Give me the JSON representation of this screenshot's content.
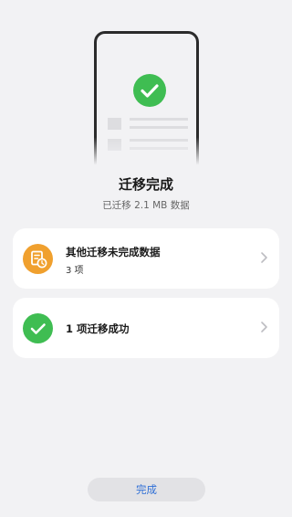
{
  "header": {
    "title": "迁移完成",
    "subtitle": "已迁移 2.1 MB 数据"
  },
  "cards": [
    {
      "title": "其他迁移未完成数据",
      "subtitle": "3 项",
      "icon": "pending-document-icon",
      "icon_color": "#f0a02e"
    },
    {
      "title": "1 项迁移成功",
      "icon": "success-check-icon",
      "icon_color": "#3fbd52"
    }
  ],
  "footer": {
    "done_label": "完成",
    "done_color": "#2f6fd6"
  }
}
